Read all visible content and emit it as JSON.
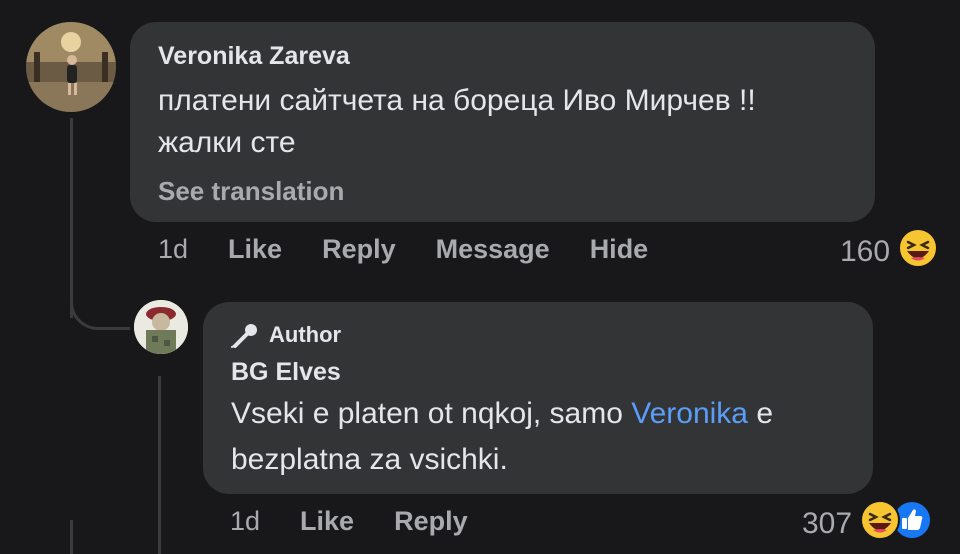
{
  "comment": {
    "author": "Veronika Zareva",
    "text_line1": "платени сайтчета на бореца Иво Мирчев !!",
    "text_line2": "жалки сте",
    "see_translation": "See translation",
    "time": "1d",
    "actions": {
      "like": "Like",
      "reply": "Reply",
      "message": "Message",
      "hide": "Hide"
    },
    "reaction_count": "160",
    "reaction_icons": [
      "laughing-emoji-icon"
    ]
  },
  "reply": {
    "badge": "Author",
    "badge_icon": "microphone-icon",
    "author": "BG Elves",
    "text_line1_prefix": "Vseki e platen ot nqkoj, samo ",
    "mention": "Veronika",
    "text_line1_suffix": " e",
    "text_line2": "bezplatna za vsichki.",
    "time": "1d",
    "actions": {
      "like": "Like",
      "reply": "Reply"
    },
    "reaction_count": "307",
    "reaction_icons": [
      "laughing-emoji-icon",
      "thumbs-up-icon"
    ]
  },
  "colors": {
    "background": "#18181a",
    "bubble": "#333436",
    "text": "#e4e6eb",
    "secondary_text": "#a8aaad",
    "mention": "#5b9df8",
    "like_blue": "#1877f2",
    "emoji_yellow": "#f7c531"
  }
}
